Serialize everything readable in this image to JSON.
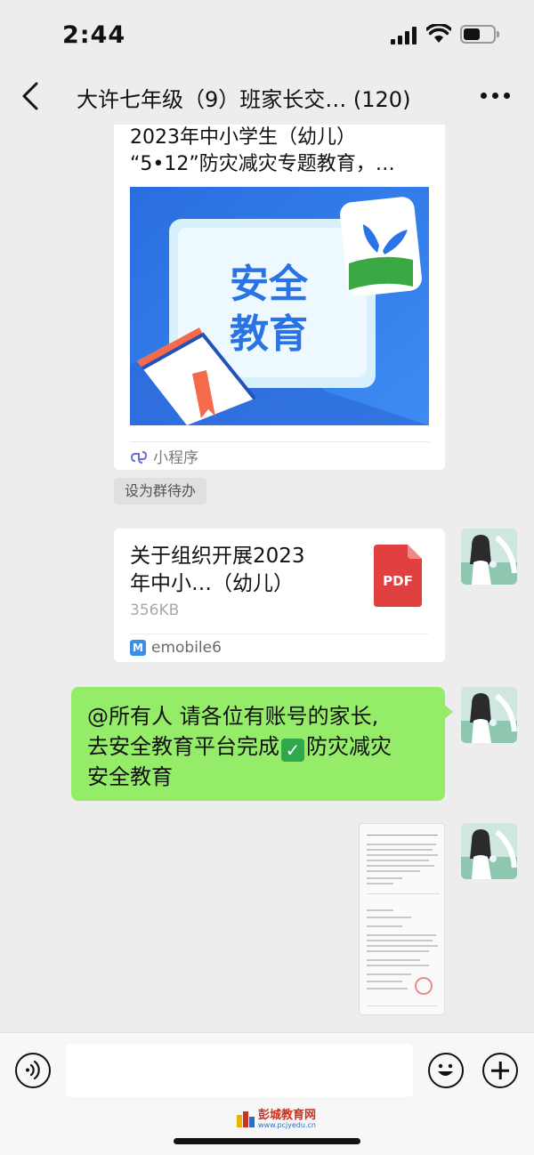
{
  "status_bar": {
    "time": "2:44",
    "battery_level": 0.55
  },
  "header": {
    "title": "大许七年级（9）班家长交…  (120)"
  },
  "messages": {
    "mini_program": {
      "title_line1": "2023年中小学生（幼儿）",
      "title_line2": "“5•12”防灾减灾专题教育，…",
      "thumb_line1": "安全",
      "thumb_line2": "教育",
      "source_label": "小程序",
      "set_todo_label": "设为群待办"
    },
    "file": {
      "name_line1": "关于组织开展2023",
      "name_line2": "年中小…（幼儿）",
      "size": "356KB",
      "type_label": "PDF",
      "source_label": "emobile6"
    },
    "text_bubble": {
      "line1": "@所有人 请各位有账号的家长,",
      "line2_before": "去安全教育平台完成",
      "line2_after": "防灾减灾",
      "line3": "安全教育"
    }
  },
  "colors": {
    "bubble_green": "#95ec69",
    "background": "#ededed",
    "pdf_red": "#e0403f",
    "thumb_blue": "#2f76e8"
  },
  "watermark": {
    "name": "彭城教育网",
    "url": "www.pcjyedu.cn"
  }
}
